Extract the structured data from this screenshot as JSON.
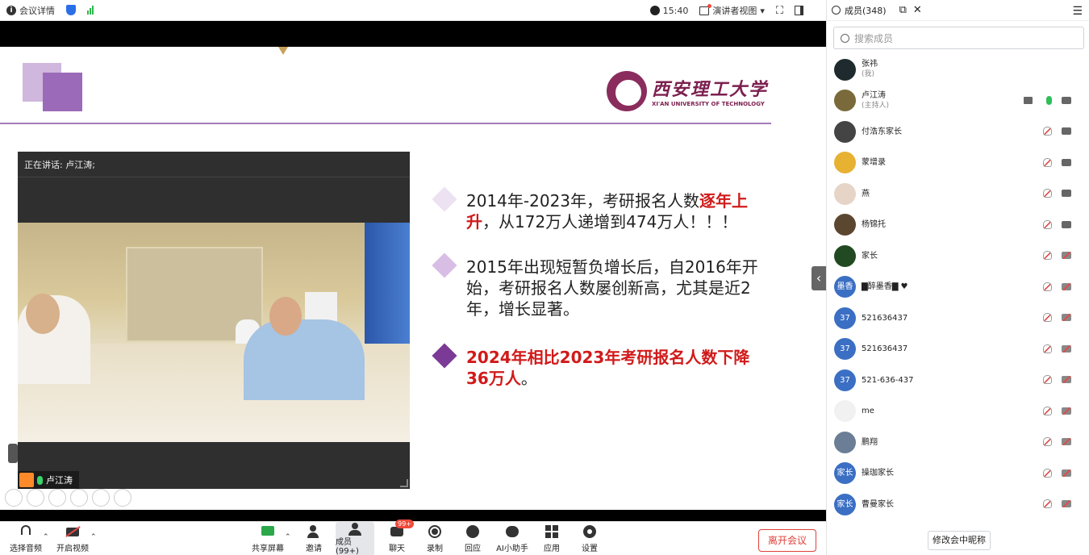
{
  "topbar": {
    "meeting_info": "会议详情",
    "time": "15:40",
    "view_mode": "演讲者视图"
  },
  "slide": {
    "bullets": [
      {
        "prefix": "2014年-2023年，考研报名人数",
        "highlight": "逐年上升",
        "suffix": "，从172万人递增到474万人！！！",
        "diamond_color": "#e6d9ee"
      },
      {
        "text": "2015年出现短暂负增长后，自2016年开始，考研报名人数屡创新高，尤其是近2年，增长显著。",
        "diamond_color": "#d6b6e3"
      },
      {
        "highlight": "2024年相比2023年考研报名人数下降36万人",
        "suffix": "。",
        "diamond_color": "#7b3a96"
      }
    ],
    "university_cn": "西安理工大学",
    "university_en": "XI'AN UNIVERSITY OF TECHNOLOGY"
  },
  "video": {
    "speaking_label": "正在讲话:  卢江涛;",
    "speaker_name": "卢江涛"
  },
  "toolbar": {
    "audio": "选择音频",
    "video": "开启视频",
    "share": "共享屏幕",
    "invite": "邀请",
    "members": "成员(99+)",
    "chat": "聊天",
    "chat_badge": "99+",
    "record": "录制",
    "reply": "回应",
    "ai": "AI小助手",
    "apps": "应用",
    "settings": "设置",
    "leave": "离开会议"
  },
  "panel": {
    "title": "成员(348)",
    "search_placeholder": "搜索成员",
    "rename_button": "修改会中昵称",
    "members": [
      {
        "name": "张祎",
        "sub": "(我)",
        "avatar": "",
        "mic": "none",
        "cam": "none"
      },
      {
        "name": "卢江涛",
        "sub": "(主持人)",
        "avatar": "",
        "mic": "on",
        "cam": "on",
        "share": true
      },
      {
        "name": "付浩东家长",
        "sub": "",
        "avatar": "",
        "mic": "off",
        "cam": "on"
      },
      {
        "name": "蒙增录",
        "sub": "",
        "avatar": "",
        "mic": "off",
        "cam": "on"
      },
      {
        "name": "燕",
        "sub": "",
        "avatar": "",
        "mic": "off",
        "cam": "on"
      },
      {
        "name": "杨锦托",
        "sub": "",
        "avatar": "",
        "mic": "off",
        "cam": "on"
      },
      {
        "name": "家长",
        "sub": "",
        "avatar": "",
        "mic": "off",
        "cam": "off"
      },
      {
        "name": "▇醉墨香▇ ♥",
        "sub": "",
        "avatar": "墨香",
        "mic": "off",
        "cam": "off"
      },
      {
        "name": "521636437",
        "sub": "",
        "avatar": "37",
        "mic": "off",
        "cam": "off"
      },
      {
        "name": "521636437",
        "sub": "",
        "avatar": "37",
        "mic": "off",
        "cam": "off"
      },
      {
        "name": "521-636-437",
        "sub": "",
        "avatar": "37",
        "mic": "off",
        "cam": "off"
      },
      {
        "name": "me",
        "sub": "",
        "avatar": "",
        "mic": "off",
        "cam": "off"
      },
      {
        "name": "鹏翔",
        "sub": "",
        "avatar": "",
        "mic": "off",
        "cam": "off"
      },
      {
        "name": "操珈家长",
        "sub": "",
        "avatar": "家长",
        "mic": "off",
        "cam": "off"
      },
      {
        "name": "曹曼家长",
        "sub": "",
        "avatar": "家长",
        "mic": "off",
        "cam": "off"
      }
    ]
  }
}
